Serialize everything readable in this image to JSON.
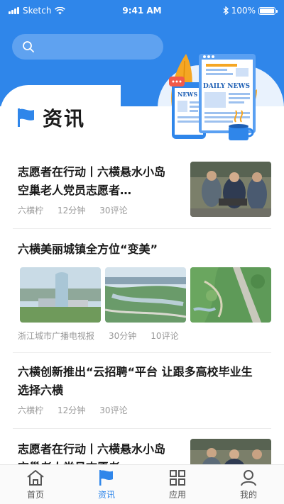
{
  "status": {
    "carrier": "Sketch",
    "time": "9:41 AM",
    "battery": "100%",
    "battery_level": 1.0
  },
  "search": {
    "icon": "search-icon"
  },
  "section": {
    "title": "资讯",
    "icon": "flag-icon"
  },
  "illustration": {
    "label_news": "NEWS",
    "label_daily": "DAILY NEWS"
  },
  "news": [
    {
      "title_line1": "志愿者在行动丨六横悬水小岛",
      "title_line2": "空巢老人党员志愿者…",
      "source": "六横柠",
      "time": "12分钟",
      "comments": "30评论"
    },
    {
      "title": "六横美丽城镇全方位“变美”",
      "source": "浙江城市广播电视报",
      "time": "30分钟",
      "comments": "10评论"
    },
    {
      "title_line1": "六横创新推出“云招聘“平台 让跟多高校毕业生",
      "title_line2": "选择六横",
      "source": "六横柠",
      "time": "12分钟",
      "comments": "30评论"
    },
    {
      "title_line1": "志愿者在行动丨六横悬水小岛",
      "title_line2": "空巢老人党员志愿者…"
    }
  ],
  "tabs": [
    {
      "label": "首页",
      "icon": "home-icon"
    },
    {
      "label": "资讯",
      "icon": "flag-icon"
    },
    {
      "label": "应用",
      "icon": "grid-icon"
    },
    {
      "label": "我的",
      "icon": "user-icon"
    }
  ],
  "colors": {
    "primary": "#2f86ea",
    "search_bg": "#5fa2f0"
  }
}
